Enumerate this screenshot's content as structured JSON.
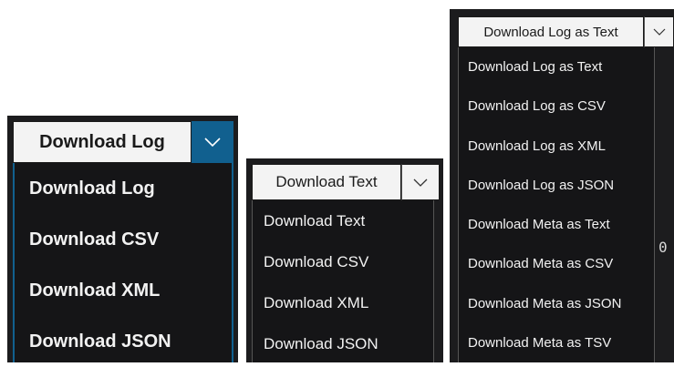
{
  "variant_large": {
    "button_label": "Download Log",
    "caret_icon": "chevron-down-icon",
    "items": [
      {
        "label": "Download Log"
      },
      {
        "label": "Download CSV"
      },
      {
        "label": "Download XML"
      },
      {
        "label": "Download JSON"
      }
    ]
  },
  "variant_medium": {
    "button_label": "Download Text",
    "caret_icon": "chevron-down-icon",
    "items": [
      {
        "label": "Download Text"
      },
      {
        "label": "Download CSV"
      },
      {
        "label": "Download XML"
      },
      {
        "label": "Download JSON"
      }
    ]
  },
  "variant_tall": {
    "button_label": "Download Log as Text",
    "caret_icon": "chevron-down-icon",
    "items": [
      {
        "label": "Download Log as Text"
      },
      {
        "label": "Download Log as CSV"
      },
      {
        "label": "Download Log as XML"
      },
      {
        "label": "Download Log as JSON"
      },
      {
        "label": "Download Meta as Text"
      },
      {
        "label": "Download Meta as CSV"
      },
      {
        "label": "Download Meta as JSON"
      },
      {
        "label": "Download Meta as TSV"
      }
    ]
  },
  "background_fragments": {
    "zero": "0"
  },
  "colors": {
    "accent_blue": "#11608f",
    "panel_dark": "#1c1c1e",
    "button_light": "#f3f3f3"
  }
}
